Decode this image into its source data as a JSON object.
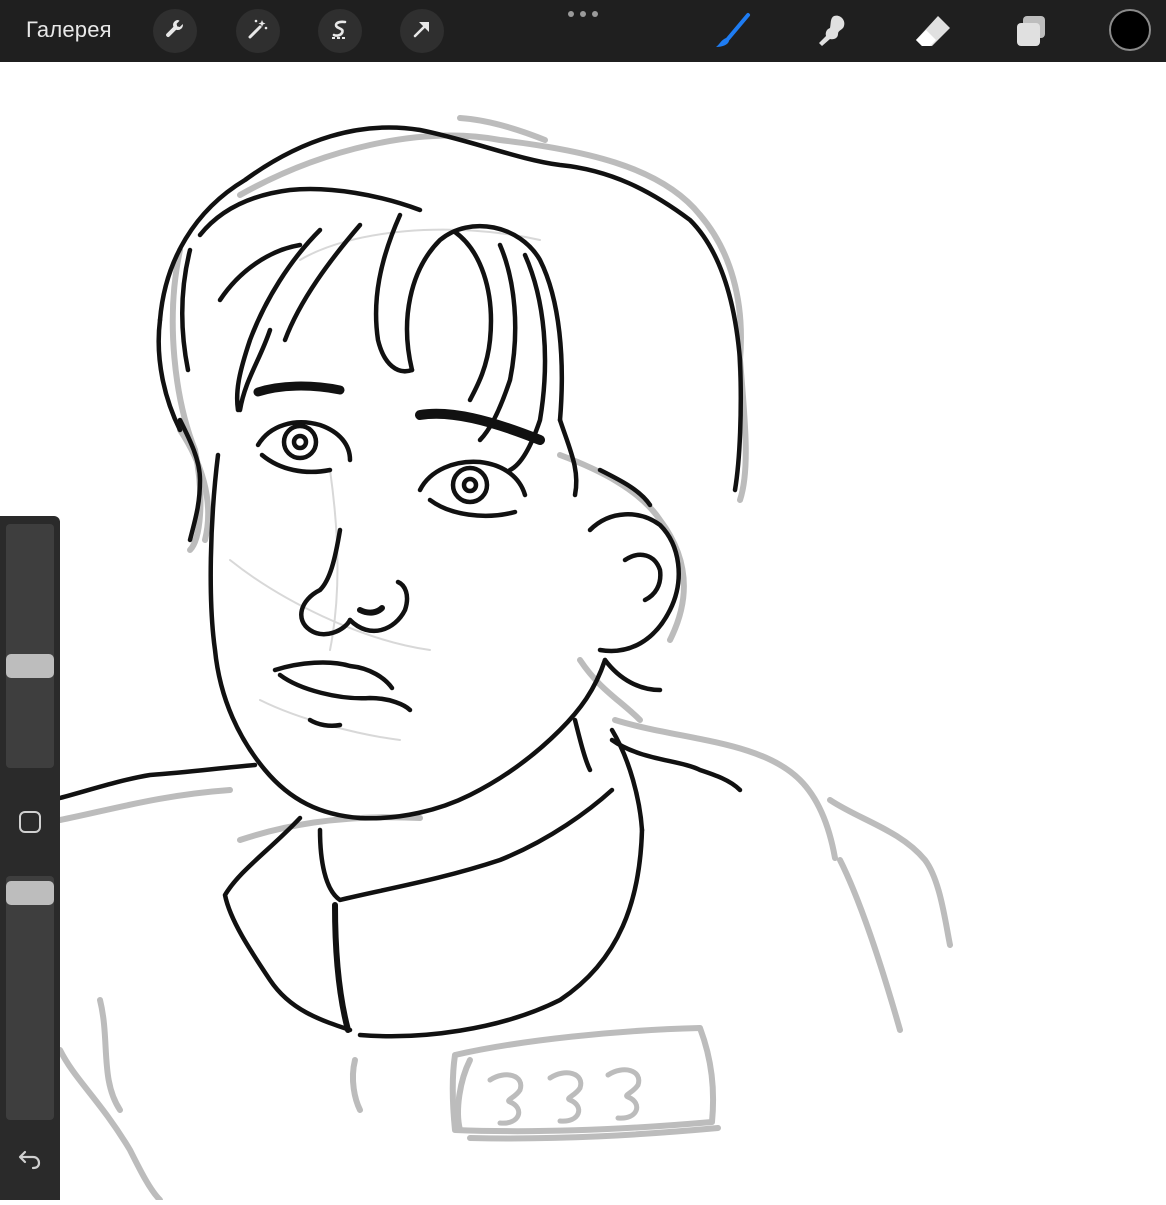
{
  "topbar": {
    "gallery_label": "Галерея",
    "left_tools": [
      {
        "icon": "wrench-icon"
      },
      {
        "icon": "magic-wand-icon"
      },
      {
        "icon": "selection-icon"
      },
      {
        "icon": "transform-arrow-icon"
      }
    ],
    "more_icon": "more-dots-icon",
    "right_tools": [
      {
        "icon": "brush-icon",
        "active": true,
        "color": "#1e7cf2"
      },
      {
        "icon": "smudge-icon",
        "active": false
      },
      {
        "icon": "eraser-icon",
        "active": false
      },
      {
        "icon": "layers-icon",
        "active": false
      }
    ],
    "current_color": "#000000"
  },
  "sidebar": {
    "brush_size_level": 0.58,
    "opacity_level": 0.86,
    "modifier_icon": "square-modifier-icon",
    "undo_icon": "undo-icon"
  },
  "canvas": {
    "tag_number": "333",
    "background": "#ffffff"
  }
}
